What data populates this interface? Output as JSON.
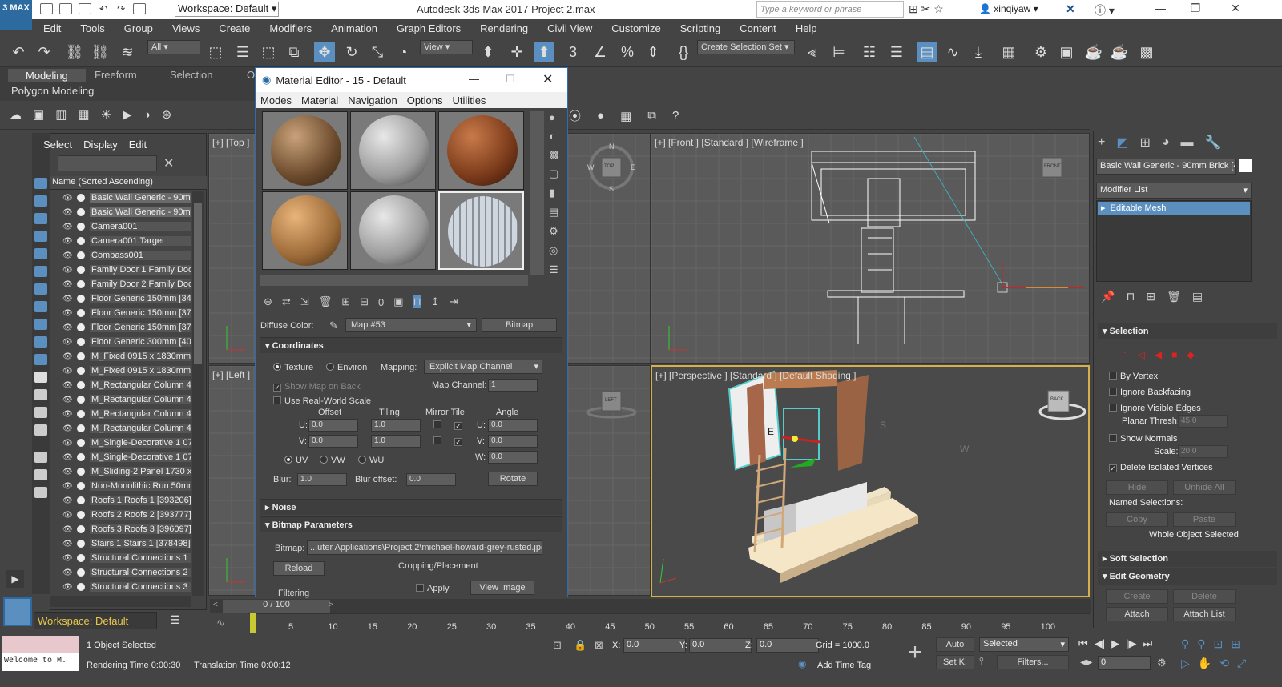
{
  "titlebar": {
    "workspace": "Workspace: Default",
    "title": "Autodesk 3ds Max 2017     Project 2.max",
    "search_placeholder": "Type a keyword or phrase",
    "user": "xinqiyaw",
    "logo": "3 MAX"
  },
  "menu": [
    "Edit",
    "Tools",
    "Group",
    "Views",
    "Create",
    "Modifiers",
    "Animation",
    "Graph Editors",
    "Rendering",
    "Civil View",
    "Customize",
    "Scripting",
    "Content",
    "Help"
  ],
  "toolbar": {
    "filter": "All",
    "ref_coord": "View",
    "selection_set": "Create Selection Set"
  },
  "ribbon": {
    "tabs": [
      "Modeling",
      "Freeform",
      "Selection"
    ],
    "overflow_tab": "O",
    "panel": "Polygon Modeling"
  },
  "explorer": {
    "menu": [
      "Select",
      "Display",
      "Edit"
    ],
    "header": "Name (Sorted Ascending)",
    "close": "✕",
    "items": [
      "Basic Wall Generic - 90mm",
      "Basic Wall Generic - 90mm",
      "Camera001",
      "Camera001.Target",
      "Compass001",
      "Family Door 1 Family Door",
      "Family Door 2 Family Door",
      "Floor Generic 150mm [343",
      "Floor Generic 150mm [372",
      "Floor Generic 150mm [373",
      "Floor Generic 300mm [408",
      "M_Fixed 0915 x 1830mm [",
      "M_Fixed 0915 x 1830mm [",
      "M_Rectangular Column 45",
      "M_Rectangular Column 45",
      "M_Rectangular Column 45",
      "M_Rectangular Column 45",
      "M_Single-Decorative 1 076",
      "M_Single-Decorative 1 076",
      "M_Sliding-2 Panel 1730 x 2",
      "Non-Monolithic Run 50mm",
      "Roofs 1 Roofs 1 [393206]",
      "Roofs 2 Roofs 2 [393777]",
      "Roofs 3 Roofs 3 [396097]",
      "Stairs 1 Stairs 1 [378498]",
      "Structural Connections 1 S",
      "Structural Connections 2 S",
      "Structural Connections 3 S"
    ],
    "workspace": "Workspace: Default"
  },
  "viewports": {
    "top": "[+] [Top ]",
    "front": "[+] [Front ] [Standard ] [Wireframe ]",
    "left": "[+] [Left ]",
    "perspective": "[+] [Perspective ] [Standard ] [Default Shading ]",
    "viewcube_top": "TOP",
    "viewcube_front": "FRONT",
    "viewcube_left": "LEFT",
    "viewcube_persp": "BACK",
    "compass": [
      "N",
      "E",
      "S",
      "W"
    ],
    "persp_letters": [
      "E",
      "S",
      "W"
    ]
  },
  "material_editor": {
    "title": "Material Editor - 15 - Default",
    "menu": [
      "Modes",
      "Material",
      "Navigation",
      "Options",
      "Utilities"
    ],
    "diffuse_label": "Diffuse Color:",
    "map_name": "Map #53",
    "map_type": "Bitmap",
    "coordinates": {
      "title": "Coordinates",
      "texture": "Texture",
      "environ": "Environ",
      "mapping_label": "Mapping:",
      "mapping": "Explicit Map Channel",
      "show_on_back": "Show Map on Back",
      "map_channel_label": "Map Channel:",
      "map_channel": "1",
      "real_world": "Use Real-World Scale",
      "headers": [
        "Offset",
        "Tiling",
        "Mirror Tile",
        "Angle"
      ],
      "u_label": "U:",
      "v_label": "V:",
      "w_label": "W:",
      "u_offset": "0.0",
      "v_offset": "0.0",
      "u_tiling": "1.0",
      "v_tiling": "1.0",
      "u_angle": "0.0",
      "v_angle": "0.0",
      "w_angle": "0.0",
      "uv": "UV",
      "vw": "VW",
      "wu": "WU",
      "blur_label": "Blur:",
      "blur": "1.0",
      "blur_offset_label": "Blur offset:",
      "blur_offset": "0.0",
      "rotate": "Rotate"
    },
    "noise": "Noise",
    "bitmap": {
      "title": "Bitmap Parameters",
      "label": "Bitmap:",
      "path": "...uter Applications\\Project 2\\michael-howard-grey-rusted.jpg",
      "reload": "Reload",
      "cropping": "Cropping/Placement",
      "apply": "Apply",
      "view_image": "View Image",
      "filtering": "Filtering"
    }
  },
  "command_panel": {
    "object_name": "Basic Wall Generic - 90mm Brick [42",
    "modifier_list": "Modifier List",
    "stack_item": "Editable Mesh",
    "selection": "Selection",
    "by_vertex": "By Vertex",
    "ignore_backfacing": "Ignore Backfacing",
    "ignore_visible_edges": "Ignore Visible Edges",
    "planar_thresh_label": "Planar Thresh:",
    "planar_thresh": "45.0",
    "show_normals": "Show Normals",
    "scale_label": "Scale:",
    "scale": "20.0",
    "delete_isolated": "Delete Isolated Vertices",
    "hide": "Hide",
    "unhide_all": "Unhide All",
    "named_selections": "Named Selections:",
    "copy": "Copy",
    "paste": "Paste",
    "whole_object": "Whole Object Selected",
    "soft_selection": "Soft Selection",
    "edit_geometry": "Edit Geometry",
    "create": "Create",
    "delete": "Delete",
    "attach": "Attach",
    "attach_list": "Attach List"
  },
  "timeline": {
    "frame": "0 / 100",
    "ticks": [
      "5",
      "10",
      "15",
      "20",
      "25",
      "30",
      "35",
      "40",
      "45",
      "50",
      "55",
      "60",
      "65",
      "70",
      "75",
      "80",
      "85",
      "90",
      "95",
      "100"
    ]
  },
  "status": {
    "welcome": "Welcome to M.",
    "selected": "1 Object Selected",
    "render_time": "Rendering Time  0:00:30",
    "translation_time": "Translation Time  0:00:12",
    "x_label": "X:",
    "y_label": "Y:",
    "z_label": "Z:",
    "x": "0.0",
    "y": "0.0",
    "z": "0.0",
    "grid": "Grid = 1000.0",
    "add_time_tag": "Add Time Tag",
    "auto": "Auto",
    "set_k": "Set K.",
    "selected_dropdown": "Selected",
    "filters": "Filters...",
    "frame_field": "0"
  },
  "colors": {
    "accent": "#2d6a9f",
    "highlight": "#5a8fc0",
    "viewport_active": "#d6b04a"
  }
}
